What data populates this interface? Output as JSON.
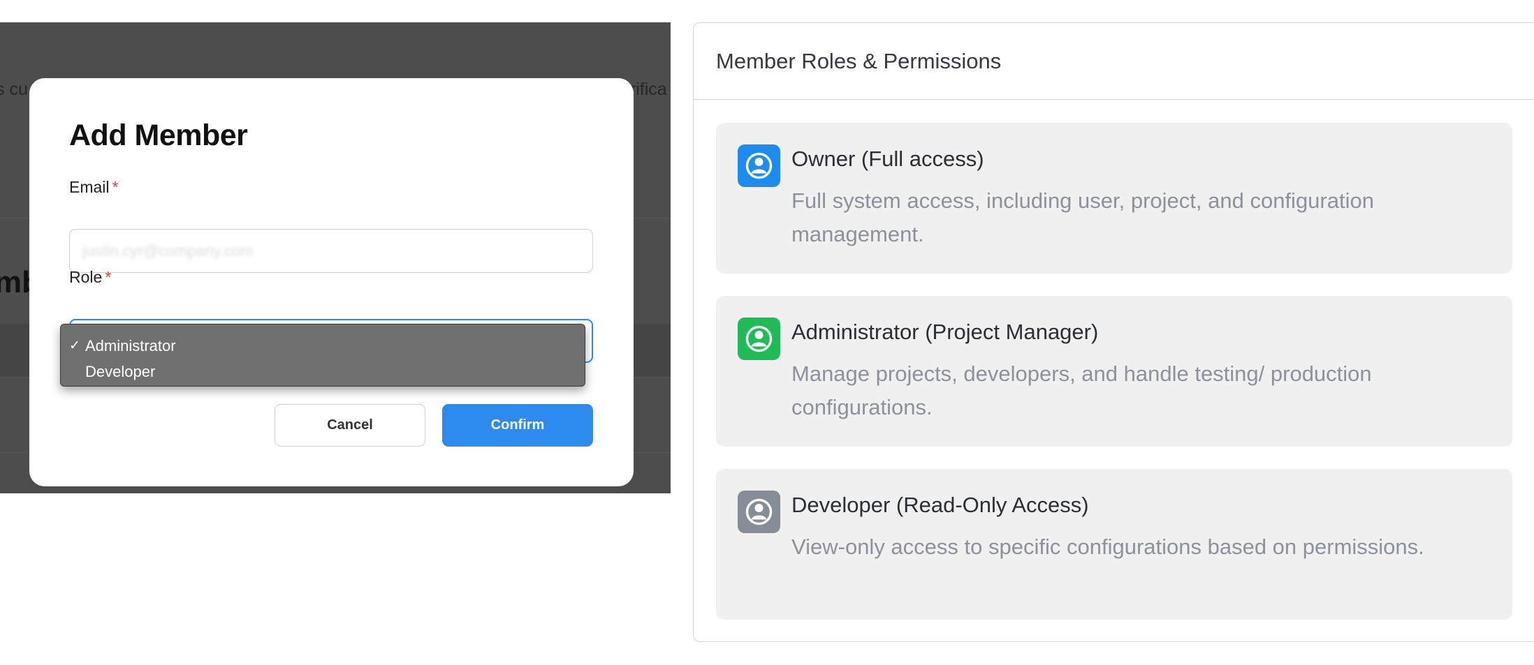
{
  "background_page": {
    "fragment_left": "s cu",
    "fragment_right": "erifica",
    "fragment_title": "mb"
  },
  "modal": {
    "title": "Add Member",
    "email_label": "Email",
    "email_placeholder": "justin.cyr@company.com",
    "role_label": "Role",
    "required_marker": "*",
    "role_options": [
      {
        "label": "Administrator",
        "checked": true
      },
      {
        "label": "Developer",
        "checked": false
      }
    ],
    "check_mark": "✓",
    "cancel_label": "Cancel",
    "confirm_label": "Confirm"
  },
  "roles_panel": {
    "title": "Member Roles & Permissions",
    "roles": [
      {
        "name": "Owner (Full access)",
        "description": "Full system access, including user, project, and configuration management.",
        "icon": "user-circle-icon",
        "color": "#1d8cf0"
      },
      {
        "name": "Administrator (Project Manager)",
        "description": "Manage projects, developers, and handle testing/ production configurations.",
        "icon": "user-circle-icon",
        "color": "#1fbb56"
      },
      {
        "name": "Developer (Read-Only Access)",
        "description": "View-only access to specific configurations based on permissions.",
        "icon": "user-circle-icon",
        "color": "#878d96"
      }
    ]
  },
  "colors": {
    "accent": "#2d8bf0",
    "required": "#e23b3b",
    "backdrop": "#4d4d4d"
  }
}
